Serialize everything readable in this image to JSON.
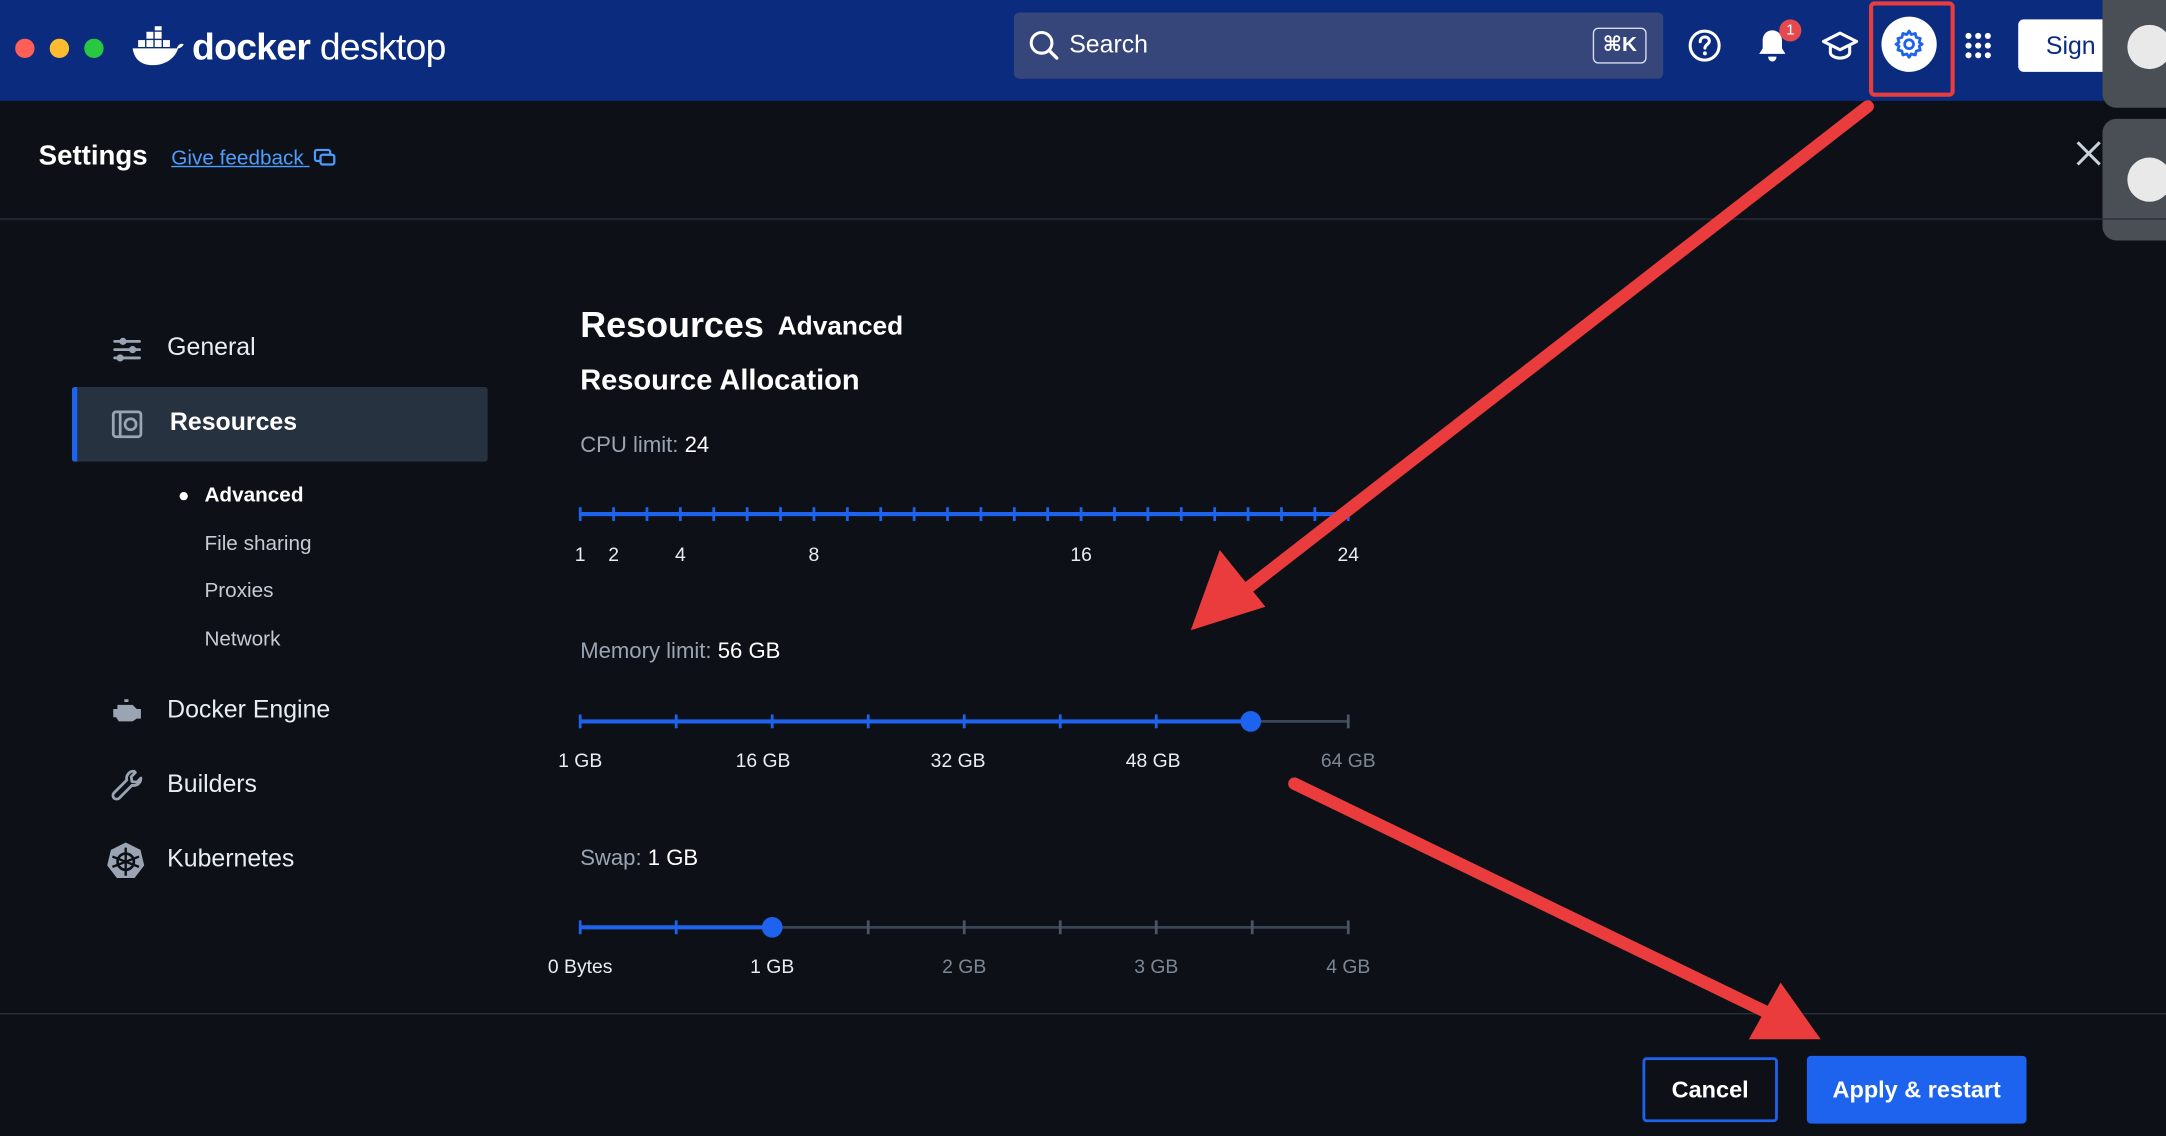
{
  "app": {
    "logo_light": "docker",
    "logo_regular": "desktop"
  },
  "search": {
    "placeholder": "Search",
    "shortcut": "⌘K"
  },
  "header": {
    "notification_count": "1",
    "sign_in_label": "Sign"
  },
  "settings": {
    "title": "Settings",
    "feedback_link": "Give feedback"
  },
  "sidebar": {
    "items": [
      {
        "label": "General",
        "icon": "sliders-icon"
      },
      {
        "label": "Resources",
        "icon": "resources-icon",
        "active": true
      },
      {
        "label": "Docker Engine",
        "icon": "engine-icon"
      },
      {
        "label": "Builders",
        "icon": "wrench-icon"
      },
      {
        "label": "Kubernetes",
        "icon": "kubernetes-icon"
      }
    ],
    "subitems": [
      "Advanced",
      "File sharing",
      "Proxies",
      "Network"
    ]
  },
  "main": {
    "title": "Resources",
    "subtitle": "Advanced",
    "section_title": "Resource Allocation",
    "cpu": {
      "label": "CPU limit:",
      "value": "24",
      "ticks": [
        "1",
        "2",
        "4",
        "8",
        "16",
        "24"
      ],
      "selected_fraction": 1.0
    },
    "memory": {
      "label": "Memory limit:",
      "value": "56 GB",
      "ticks": [
        "1 GB",
        "16 GB",
        "32 GB",
        "48 GB",
        "64 GB"
      ],
      "selected_gb": 56
    },
    "swap": {
      "label": "Swap:",
      "value": "1 GB",
      "ticks": [
        "0 Bytes",
        "1 GB",
        "2 GB",
        "3 GB",
        "4 GB"
      ],
      "selected_gb": 1
    }
  },
  "footer": {
    "cancel_label": "Cancel",
    "apply_label": "Apply & restart"
  },
  "colors": {
    "topbar": "#0b2c7e",
    "accent": "#1d63ed",
    "annotation": "#ea3c3c"
  }
}
